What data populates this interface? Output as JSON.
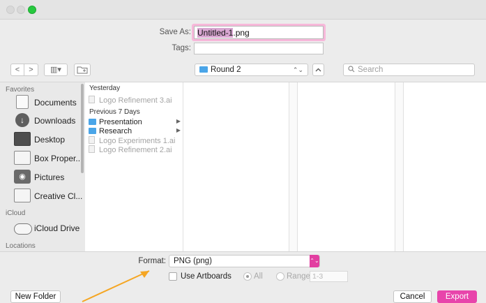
{
  "dialog": {
    "save_as_label": "Save As:",
    "filename_selected": "Untitled-1",
    "filename_ext": ".png",
    "tags_label": "Tags:"
  },
  "toolbar": {
    "back": "<",
    "forward": ">",
    "view": "▥▾",
    "location": "Round 2",
    "search_placeholder": "Search",
    "search_icon": "search-icon"
  },
  "sidebar": {
    "favorites_heading": "Favorites",
    "favorites": [
      {
        "label": "Documents",
        "icon": "documents-icon"
      },
      {
        "label": "Downloads",
        "icon": "downloads-icon"
      },
      {
        "label": "Desktop",
        "icon": "desktop-icon"
      },
      {
        "label": "Box Proper...",
        "icon": "folder-icon"
      },
      {
        "label": "Pictures",
        "icon": "camera-icon"
      },
      {
        "label": "Creative Cl...",
        "icon": "folder-icon"
      }
    ],
    "icloud_heading": "iCloud",
    "icloud": [
      {
        "label": "iCloud Drive",
        "icon": "cloud-icon"
      }
    ],
    "locations_heading": "Locations"
  },
  "browser": {
    "yesterday_heading": "Yesterday",
    "yesterday_files": [
      {
        "name": "Logo Refinement 3.ai",
        "dim": true
      }
    ],
    "prev7_heading": "Previous 7 Days",
    "prev7_items": [
      {
        "name": "Presentation",
        "type": "folder"
      },
      {
        "name": "Research",
        "type": "folder"
      },
      {
        "name": "Logo Experiments 1.ai",
        "type": "file",
        "dim": true
      },
      {
        "name": "Logo Refinement 2.ai",
        "type": "file",
        "dim": true
      }
    ]
  },
  "format": {
    "label": "Format:",
    "value": "PNG (png)",
    "use_artboards": "Use Artboards",
    "all_label": "All",
    "range_label": "Range:",
    "range_value": "1-3"
  },
  "buttons": {
    "new_folder": "New Folder",
    "cancel": "Cancel",
    "export": "Export"
  },
  "colors": {
    "accent": "#e844ab",
    "folder": "#4aa5e8",
    "annotation_arrow": "#f5a623"
  }
}
